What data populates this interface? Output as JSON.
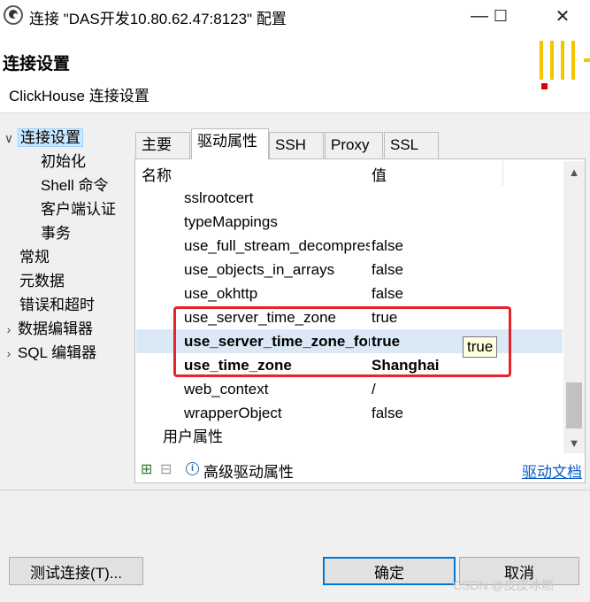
{
  "window": {
    "title": "连接 \"DAS开发10.80.62.47:8123\" 配置",
    "controls": {
      "minimize": "—",
      "maximize": "☐",
      "close": "✕"
    }
  },
  "header": {
    "title": "连接设置",
    "subtitle": "ClickHouse 连接设置"
  },
  "sidebar": {
    "items": [
      {
        "label": "连接设置",
        "arrow": "∨",
        "selected": true
      },
      {
        "label": "初始化"
      },
      {
        "label": "Shell 命令"
      },
      {
        "label": "客户端认证"
      },
      {
        "label": "事务"
      },
      {
        "label": "常规"
      },
      {
        "label": "元数据"
      },
      {
        "label": "错误和超时"
      },
      {
        "label": "数据编辑器",
        "arrow": "›"
      },
      {
        "label": "SQL 编辑器",
        "arrow": "›"
      }
    ]
  },
  "tabs": [
    {
      "label": "主要"
    },
    {
      "label": "驱动属性",
      "active": true
    },
    {
      "label": "SSH"
    },
    {
      "label": "Proxy"
    },
    {
      "label": "SSL"
    }
  ],
  "properties": {
    "headers": {
      "name": "名称",
      "value": "值"
    },
    "rows": [
      {
        "name": "sslrootcert",
        "value": ""
      },
      {
        "name": "typeMappings",
        "value": ""
      },
      {
        "name": "use_full_stream_decompression",
        "value": "false"
      },
      {
        "name": "use_objects_in_arrays",
        "value": "false"
      },
      {
        "name": "use_okhttp",
        "value": "false"
      },
      {
        "name": "use_server_time_zone",
        "value": "true"
      },
      {
        "name": "use_server_time_zone_for_dates",
        "value": "true",
        "bold": true,
        "highlight": true
      },
      {
        "name": "use_time_zone",
        "value": "Shanghai",
        "bold": true
      },
      {
        "name": "web_context",
        "value": "/"
      },
      {
        "name": "wrapperObject",
        "value": "false"
      }
    ],
    "group": "用户属性",
    "tooltip": "true"
  },
  "panel_footer": {
    "advanced_label": "高级驱动属性",
    "doc_link": "驱动文档"
  },
  "buttons": {
    "test": "测试连接(T)...",
    "ok": "确定",
    "cancel": "取消"
  },
  "watermark": "CSDN @皮皮冰燃"
}
